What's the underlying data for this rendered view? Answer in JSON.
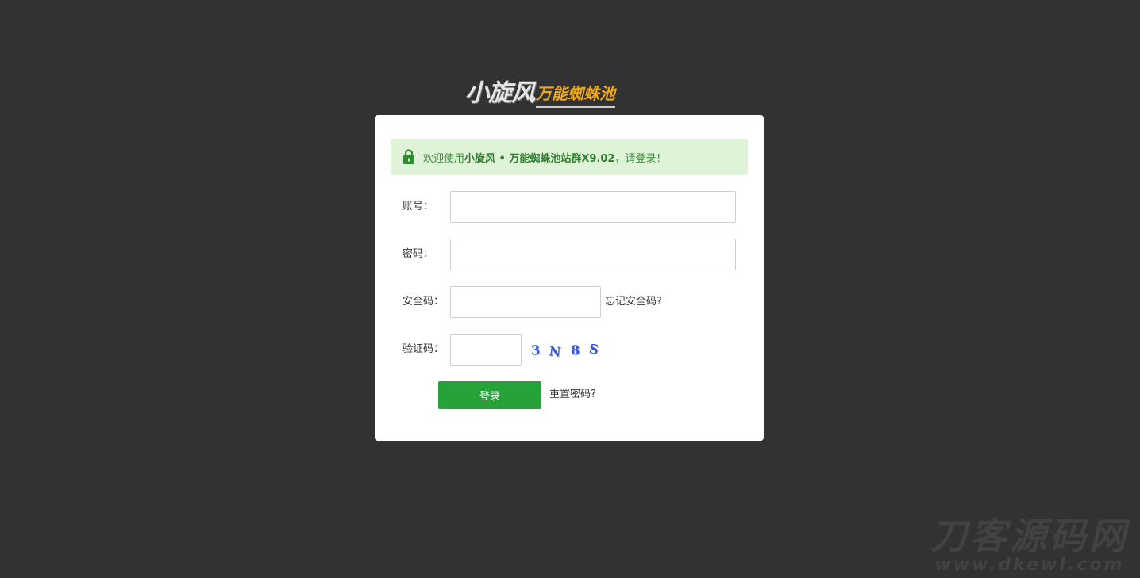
{
  "logo": {
    "main": "小旋风",
    "sub": "万能蜘蛛池"
  },
  "notice": {
    "prefix": "欢迎使用",
    "product": "小旋风 • 万能蜘蛛池站群X9.02",
    "suffix": "，请登录！",
    "icon": "lock-icon"
  },
  "form": {
    "account_label": "账号：",
    "account_value": "",
    "password_label": "密码：",
    "password_value": "",
    "security_label": "安全码：",
    "security_value": "",
    "forgot_security": "忘记安全码?",
    "captcha_label": "验证码：",
    "captcha_value": "",
    "captcha_chars": [
      "3",
      "N",
      "8",
      "S"
    ],
    "login_button": "登录",
    "reset_password": "重置密码?"
  },
  "watermark": {
    "cn": "刀客源码网",
    "en": "www.dkewl.com"
  },
  "colors": {
    "background": "#323232",
    "panel": "#ffffff",
    "notice_bg": "#dff3d8",
    "notice_text": "#3c8a3c",
    "button": "#25a338",
    "captcha": "#3557c8",
    "logo_accent": "#f0a818"
  }
}
